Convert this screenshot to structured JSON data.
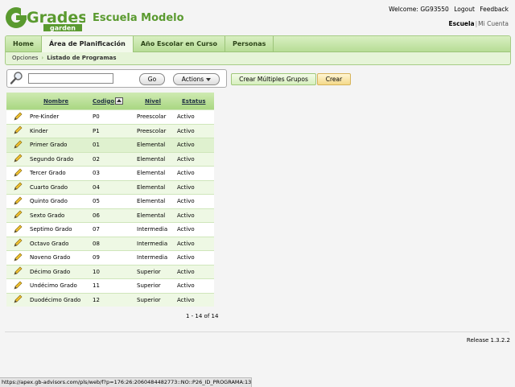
{
  "header": {
    "logo_word1": "Grades",
    "logo_word2": "garden",
    "school": "Escuela Modelo",
    "welcome": "Welcome: GG93550",
    "logout": "Logout",
    "feedback": "Feedback",
    "toggle_active": "Escuela",
    "toggle_separator": "|",
    "toggle_other": "Mi Cuenta"
  },
  "nav": {
    "tabs": [
      {
        "label": "Home",
        "active": false
      },
      {
        "label": "Área de Planificación",
        "active": true
      },
      {
        "label": "Año Escolar en Curso",
        "active": false
      },
      {
        "label": "Personas",
        "active": false
      }
    ],
    "breadcrumb": {
      "parent": "Opciones",
      "current": "Listado de Programas"
    }
  },
  "toolbar": {
    "search_value": "",
    "go_label": "Go",
    "actions_label": "Actions",
    "multi_label": "Crear Múltiples Grupos",
    "create_label": "Crear"
  },
  "table": {
    "headers": [
      "Nombre",
      "Codigo",
      "Nivel",
      "Estatus"
    ],
    "rows": [
      [
        "Pre-Kinder",
        "P0",
        "Preescolar",
        "Activo"
      ],
      [
        "Kinder",
        "P1",
        "Preescolar",
        "Activo"
      ],
      [
        "Primer Grado",
        "01",
        "Elemental",
        "Activo"
      ],
      [
        "Segundo Grado",
        "02",
        "Elemental",
        "Activo"
      ],
      [
        "Tercer Grado",
        "03",
        "Elemental",
        "Activo"
      ],
      [
        "Cuarto Grado",
        "04",
        "Elemental",
        "Activo"
      ],
      [
        "Quinto Grado",
        "05",
        "Elemental",
        "Activo"
      ],
      [
        "Sexto Grado",
        "06",
        "Elemental",
        "Activo"
      ],
      [
        "Septimo Grado",
        "07",
        "Intermedia",
        "Activo"
      ],
      [
        "Octavo Grado",
        "08",
        "Intermedia",
        "Activo"
      ],
      [
        "Noveno Grado",
        "09",
        "Intermedia",
        "Activo"
      ],
      [
        "Décimo Grado",
        "10",
        "Superior",
        "Activo"
      ],
      [
        "Undécimo Grado",
        "11",
        "Superior",
        "Activo"
      ],
      [
        "Duodécimo Grado",
        "12",
        "Superior",
        "Activo"
      ]
    ],
    "pagination": "1 - 14 of 14"
  },
  "footer": {
    "release": "Release 1.3.2.2",
    "status_url": "https://apex.gb-advisors.com/pls/web/f?p=176:26:2060484482773::NO::P26_ID_PROGRAMA:1363"
  },
  "colors": {
    "brand_green": "#5a9a2f",
    "tab_green": "#b7dd96",
    "row_alt": "#eef8e4"
  }
}
